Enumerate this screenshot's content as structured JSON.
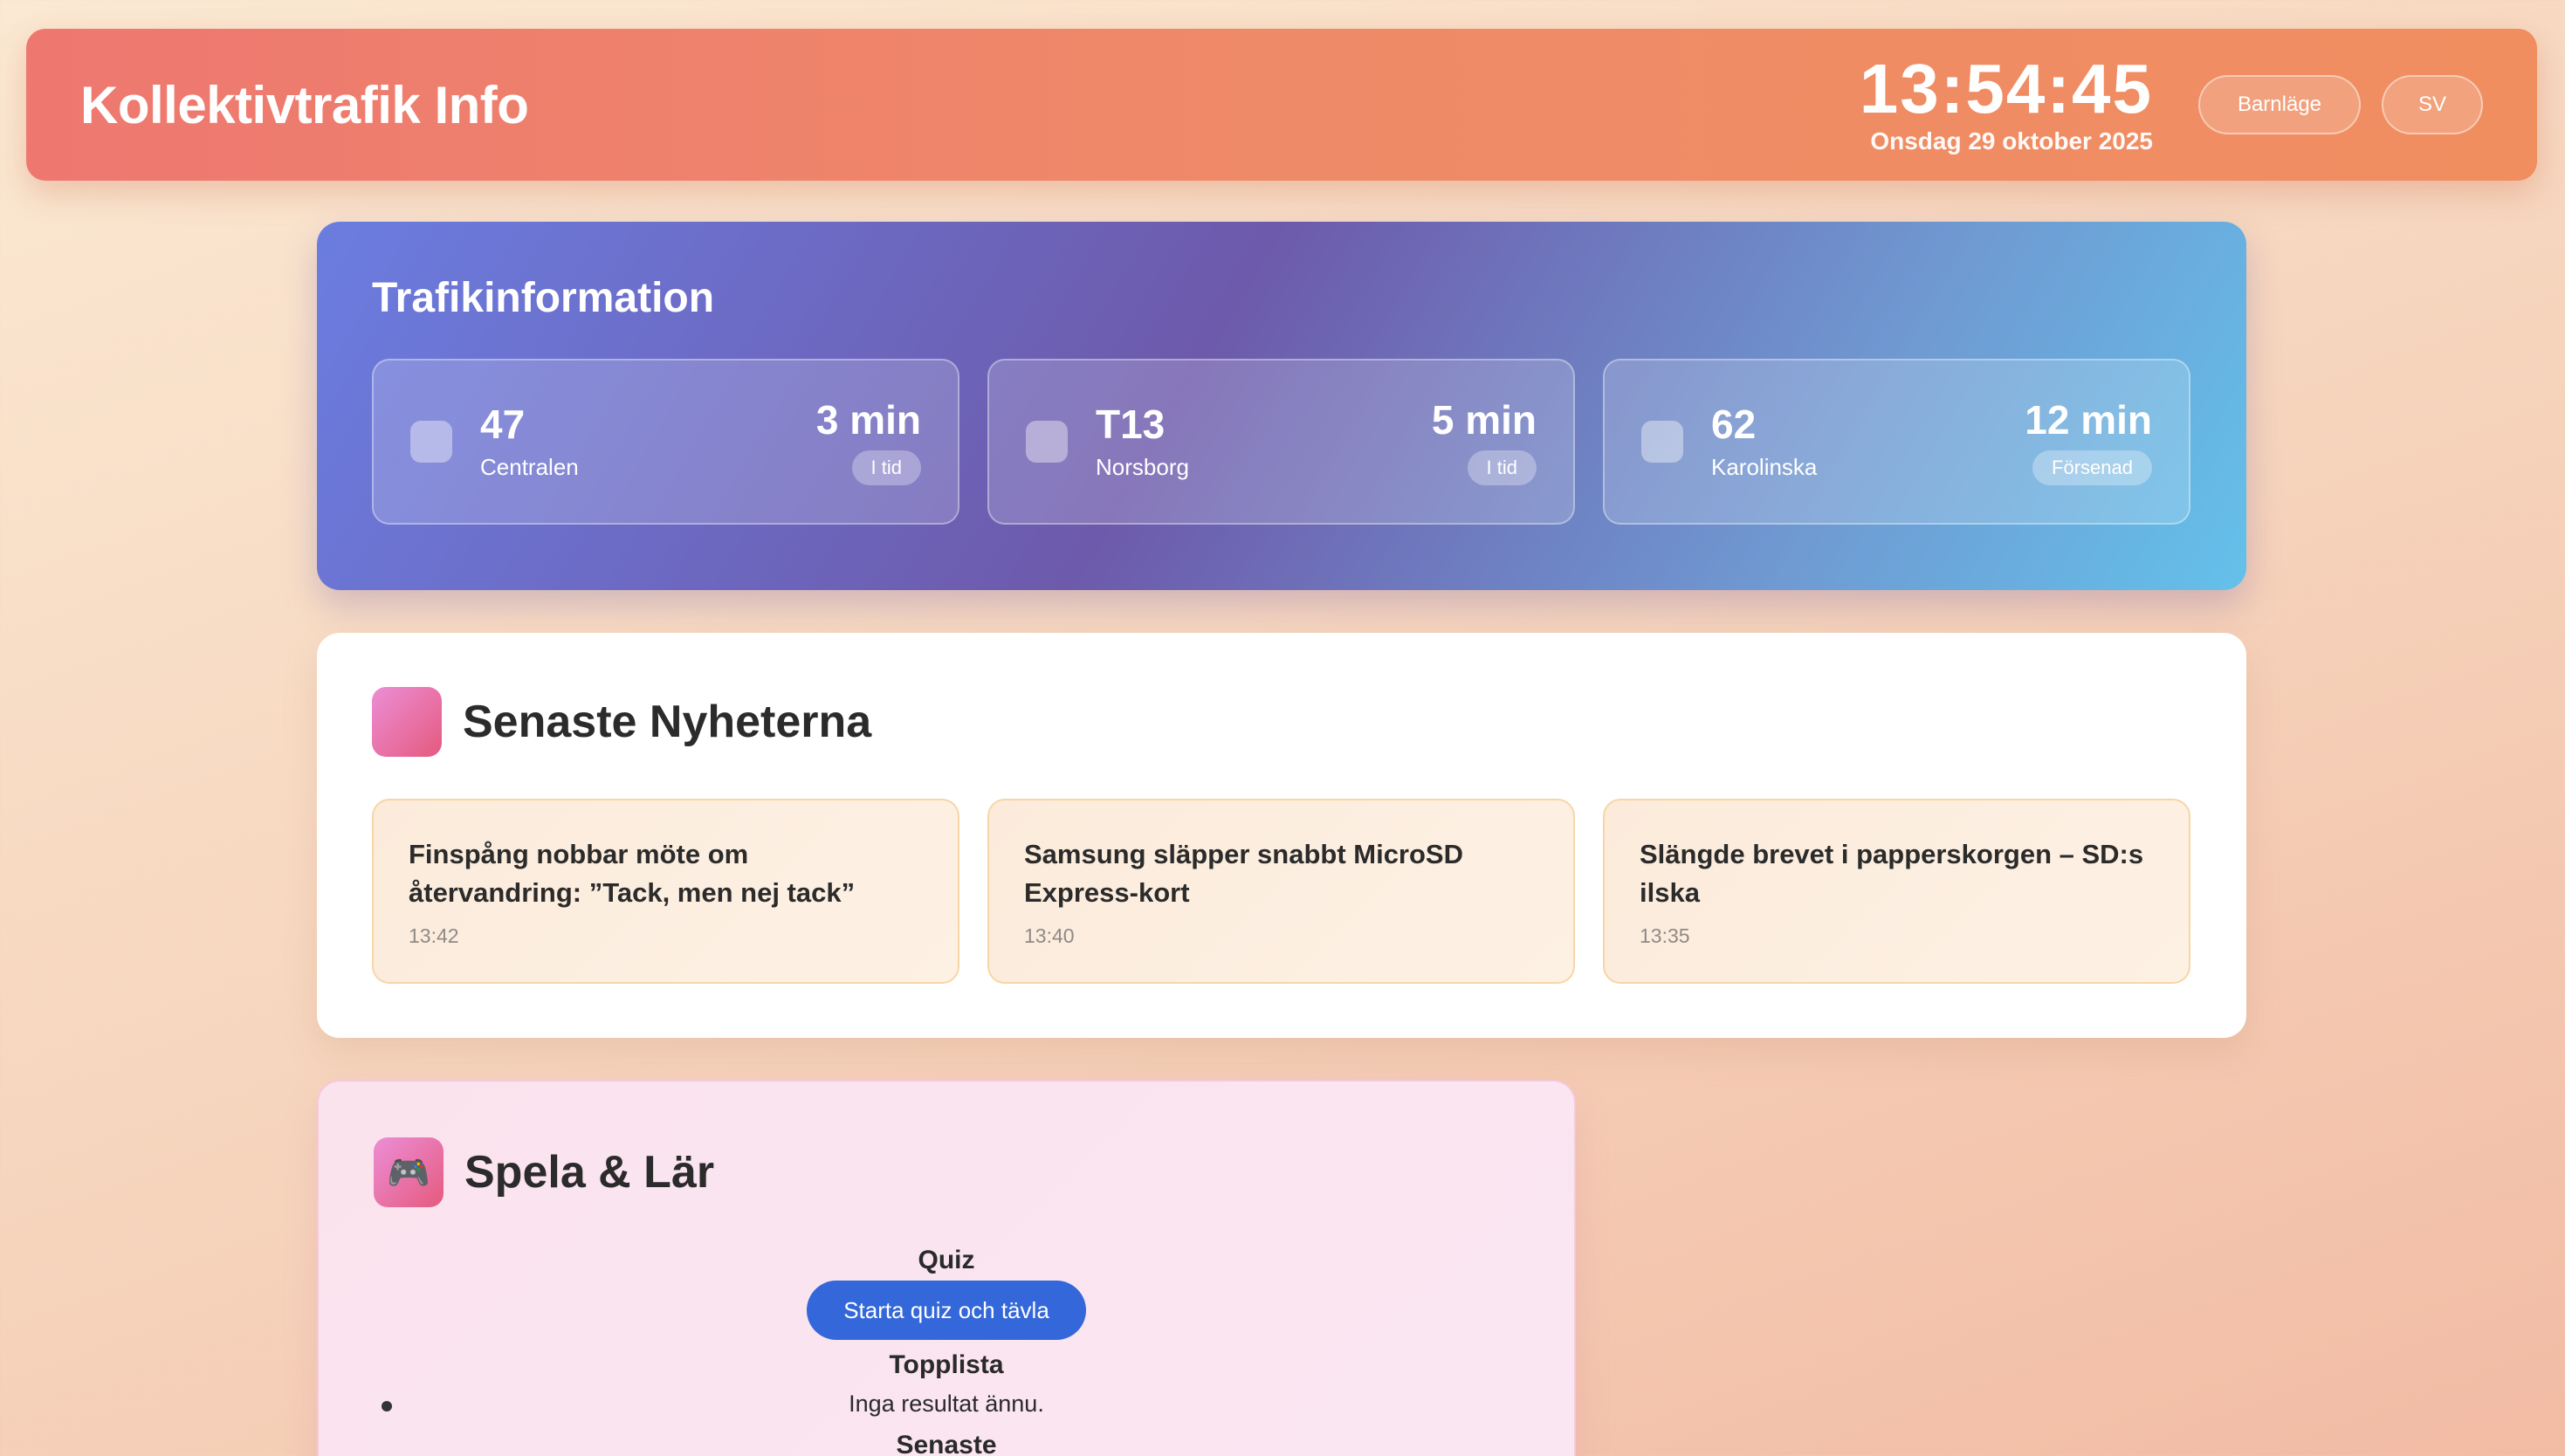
{
  "header": {
    "title": "Kollektivtrafik Info",
    "clock": "13:54:45",
    "date": "Onsdag 29 oktober 2025",
    "child_mode_label": "Barnläge",
    "language_label": "SV"
  },
  "traffic": {
    "title": "Trafikinformation",
    "departures": [
      {
        "line": "47",
        "destination": "Centralen",
        "time": "3 min",
        "status": "I tid"
      },
      {
        "line": "T13",
        "destination": "Norsborg",
        "time": "5 min",
        "status": "I tid"
      },
      {
        "line": "62",
        "destination": "Karolinska",
        "time": "12 min",
        "status": "Försenad"
      }
    ]
  },
  "news": {
    "title": "Senaste Nyheterna",
    "items": [
      {
        "headline": "Finspång nobbar möte om återvandring: ”Tack, men nej tack”",
        "time": "13:42"
      },
      {
        "headline": "Samsung släpper snabbt MicroSD Express-kort",
        "time": "13:40"
      },
      {
        "headline": "Slängde brevet i papperskorgen – SD:s ilska",
        "time": "13:35"
      }
    ]
  },
  "game": {
    "title": "Spela & Lär",
    "icon": "🎮",
    "quiz_label": "Quiz",
    "quiz_button": "Starta quiz och tävla",
    "leaderboard_label": "Topplista",
    "leaderboard_empty": "Inga resultat ännu.",
    "latest_label": "Senaste"
  }
}
